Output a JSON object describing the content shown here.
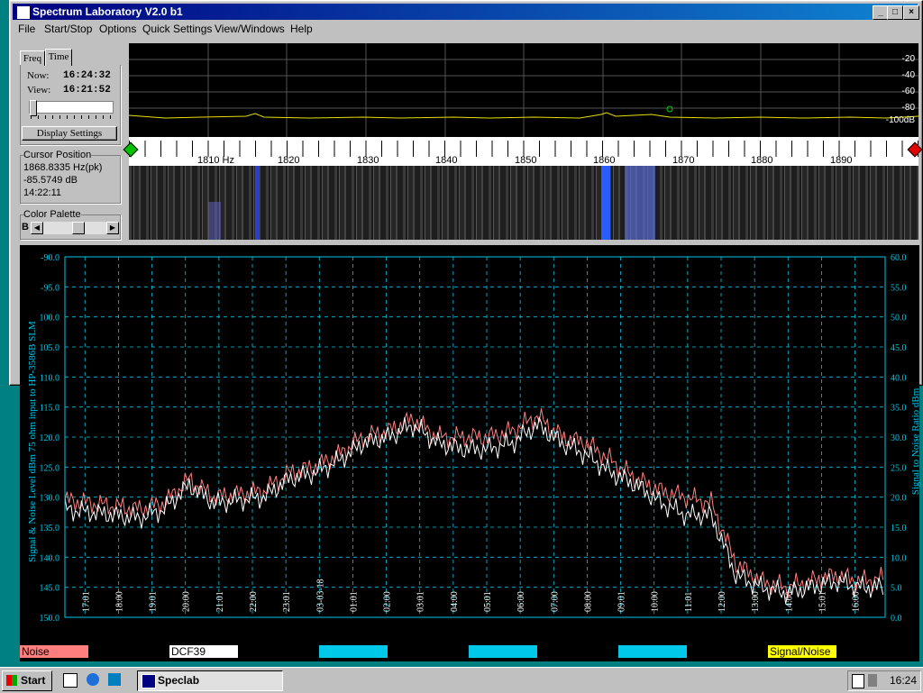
{
  "window": {
    "title": "Spectrum Laboratory V2.0 b1"
  },
  "menu": [
    "File",
    "Start/Stop",
    "Options",
    "Quick Settings",
    "View/Windows",
    "Help"
  ],
  "left_panel": {
    "tabs": [
      "Freq",
      "Time"
    ],
    "now_label": "Now:",
    "now_value": "16:24:32",
    "view_label": "View:",
    "view_value": "16:21:52",
    "display_settings": "Display Settings",
    "cursor_title": "Cursor Position",
    "cursor_freq": "1868.8335 Hz(pk)",
    "cursor_db": "-85.5749 dB",
    "cursor_time": "14:22:11",
    "palette_title": "Color Palette",
    "palette_b": "B"
  },
  "spectrum": {
    "db_labels": [
      "-20",
      "-40",
      "-60",
      "-80",
      "-100dB"
    ],
    "freq_labels": [
      "1810 Hz",
      "1820",
      "1830",
      "1840",
      "1850",
      "1860",
      "1870",
      "1880",
      "1890"
    ]
  },
  "chart_data": {
    "type": "line",
    "left_ylabel": "Signal & Noise Level dBm 75 ohm input to HP-3586B SLM",
    "right_ylabel": "Signal to Noise Ratio dBm",
    "ylim_left": [
      -150,
      -90
    ],
    "ylim_right": [
      0,
      60
    ],
    "left_ticks": [
      "-90.0",
      "-95.0",
      "100.0",
      "105.0",
      "110.0",
      "115.0",
      "120.0",
      "125.0",
      "130.0",
      "135.0",
      "140.0",
      "145.0",
      "150.0"
    ],
    "right_ticks": [
      "60.0",
      "55.0",
      "50.0",
      "45.0",
      "40.0",
      "35.0",
      "30.0",
      "25.0",
      "20.0",
      "15.0",
      "10.0",
      "5.0",
      "0.0"
    ],
    "x_ticks": [
      "17:01",
      "18:00",
      "19:01",
      "20:00",
      "21:01",
      "22:00",
      "23:01",
      "03-03-18",
      "01:01",
      "02:00",
      "03:01",
      "04:00",
      "05:01",
      "06:00",
      "07:00",
      "08:00",
      "09:01",
      "10:00",
      "11:01",
      "12:00",
      "13:00",
      "14:00",
      "15:01",
      "16:00"
    ],
    "grid": true,
    "series": [
      {
        "name": "Noise",
        "color": "#ff7f7f",
        "values": [
          -130.5,
          -131,
          -131.5,
          -132,
          -131,
          -127,
          -130,
          -129.5,
          -129,
          -126,
          -125,
          -123,
          -120,
          -119,
          -117,
          -120,
          -120,
          -120,
          -119,
          -116.5,
          -120,
          -121,
          -124,
          -127,
          -129,
          -130,
          -131,
          -141,
          -144,
          -145,
          -144,
          -143,
          -144,
          -143.5
        ]
      },
      {
        "name": "DCF39",
        "color": "#ffffff",
        "values": [
          -132,
          -132.5,
          -133,
          -133.5,
          -132,
          -128,
          -131,
          -130.5,
          -130,
          -127,
          -126,
          -124,
          -121,
          -120,
          -118,
          -121,
          -122,
          -122,
          -121,
          -118,
          -121,
          -123,
          -126,
          -128,
          -131,
          -133,
          -133,
          -143,
          -145,
          -146,
          -145,
          -144,
          -145,
          -145
        ]
      },
      {
        "name": "",
        "color": "#00c8e8",
        "values": []
      },
      {
        "name": "",
        "color": "#00c8e8",
        "values": []
      },
      {
        "name": "",
        "color": "#00c8e8",
        "values": []
      },
      {
        "name": "Signal/Noise",
        "color": "#ffff00",
        "values": []
      }
    ]
  },
  "legend": [
    {
      "label": "Noise",
      "bg": "#ff7f7f",
      "fg": "#000000"
    },
    {
      "label": "DCF39",
      "bg": "#ffffff",
      "fg": "#000000"
    },
    {
      "label": "",
      "bg": "#00c8e8",
      "fg": "#000000"
    },
    {
      "label": "",
      "bg": "#00c8e8",
      "fg": "#000000"
    },
    {
      "label": "",
      "bg": "#00c8e8",
      "fg": "#000000"
    },
    {
      "label": "Signal/Noise",
      "bg": "#ffff00",
      "fg": "#000000"
    }
  ],
  "taskbar": {
    "start": "Start",
    "task": "Speclab",
    "clock": "16:24"
  }
}
